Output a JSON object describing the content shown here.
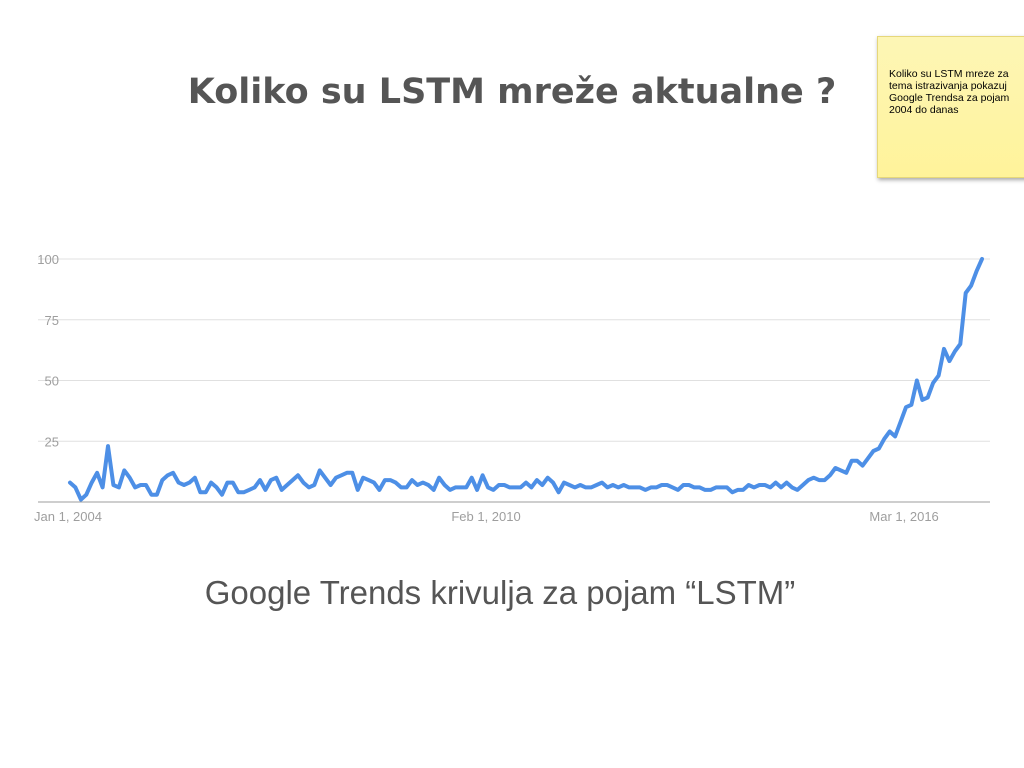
{
  "slide": {
    "title": "Koliko su LSTM mreže aktualne ?",
    "caption": "Google Trends krivulja za pojam “LSTM”"
  },
  "sticky_note": {
    "text": "Koliko su LSTM mreze za\ntema istrazivanja pokazuj\nGoogle Trendsa za pojam\n2004 do danas"
  },
  "colors": {
    "line": "#4d8fe6",
    "grid": "#e0e0e0",
    "axis": "#9e9e9e",
    "title": "#555555"
  },
  "chart_data": {
    "type": "line",
    "title": "",
    "xlabel": "",
    "ylabel": "",
    "ylim": [
      0,
      100
    ],
    "yticks": [
      25,
      50,
      75,
      100
    ],
    "grid": true,
    "xticks": [
      {
        "label": "Jan 1, 2004",
        "date": "2004-01"
      },
      {
        "label": "Feb 1, 2010",
        "date": "2010-02"
      },
      {
        "label": "Mar 1, 2016",
        "date": "2016-03"
      }
    ],
    "x_range": [
      "2004-01",
      "2017-06"
    ],
    "series": [
      {
        "values": [
          8,
          6,
          1,
          3,
          8,
          12,
          6,
          23,
          7,
          6,
          13,
          10,
          6,
          7,
          7,
          3,
          3,
          9,
          11,
          12,
          8,
          7,
          8,
          10,
          4,
          4,
          8,
          6,
          3,
          8,
          8,
          4,
          4,
          5,
          6,
          9,
          5,
          9,
          10,
          5,
          7,
          9,
          11,
          8,
          6,
          7,
          13,
          10,
          7,
          10,
          11,
          12,
          12,
          5,
          10,
          9,
          8,
          5,
          9,
          9,
          8,
          6,
          6,
          9,
          7,
          8,
          7,
          5,
          10,
          7,
          5,
          6,
          6,
          6,
          10,
          5,
          11,
          6,
          5,
          7,
          7,
          6,
          6,
          6,
          8,
          6,
          9,
          7,
          10,
          8,
          4,
          8,
          7,
          6,
          7,
          6,
          6,
          7,
          8,
          6,
          7,
          6,
          7,
          6,
          6,
          6,
          5,
          6,
          6,
          7,
          7,
          6,
          5,
          7,
          7,
          6,
          6,
          5,
          5,
          6,
          6,
          6,
          4,
          5,
          5,
          7,
          6,
          7,
          7,
          6,
          8,
          6,
          8,
          6,
          5,
          7,
          9,
          10,
          9,
          9,
          11,
          14,
          13,
          12,
          17,
          17,
          15,
          18,
          21,
          22,
          26,
          29,
          27,
          33,
          39,
          40,
          50,
          42,
          43,
          49,
          52,
          63,
          58,
          62,
          65,
          86,
          89,
          95,
          100
        ]
      }
    ]
  }
}
